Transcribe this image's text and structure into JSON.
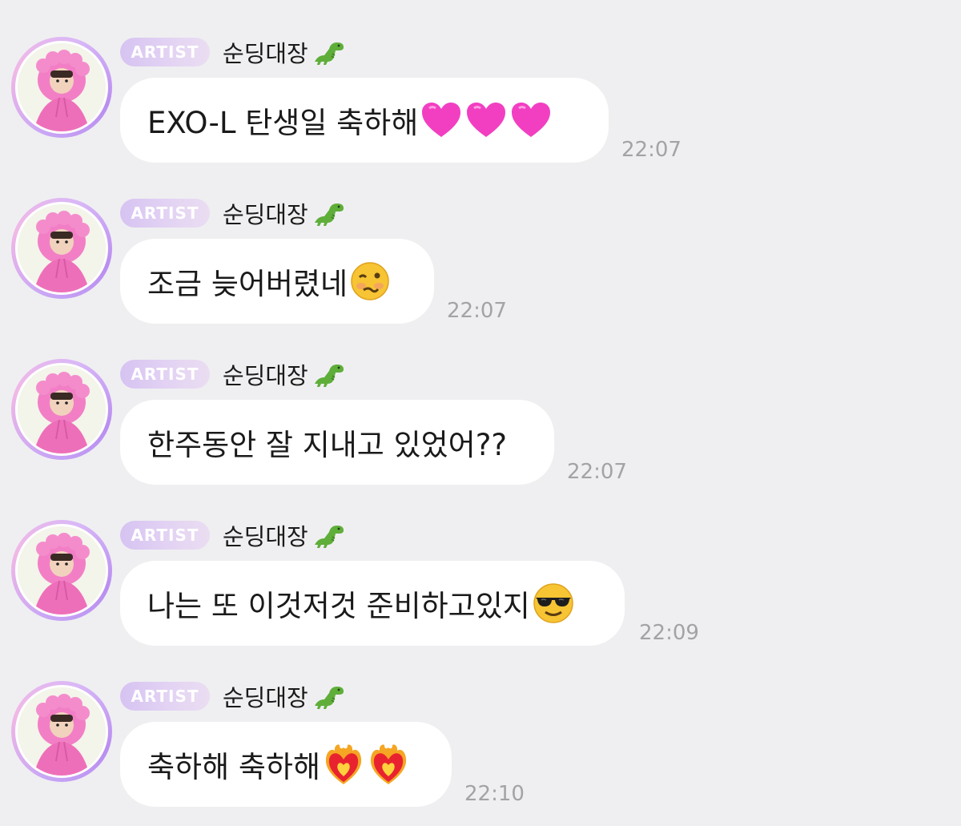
{
  "messages": [
    {
      "badge": "ARTIST",
      "sender": "순딩대장",
      "sender_icon": "t-rex-icon",
      "text": "EXO-L 탄생일 축하해",
      "emojis": [
        "pink-heart-icon",
        "pink-heart-icon",
        "pink-heart-icon"
      ],
      "time": "22:07"
    },
    {
      "badge": "ARTIST",
      "sender": "순딩대장",
      "sender_icon": "t-rex-icon",
      "text": "조금 늦어버렸네",
      "emojis": [
        "woozy-face-icon"
      ],
      "time": "22:07"
    },
    {
      "badge": "ARTIST",
      "sender": "순딩대장",
      "sender_icon": "t-rex-icon",
      "text": "한주동안 잘 지내고 있었어??",
      "emojis": [],
      "time": "22:07"
    },
    {
      "badge": "ARTIST",
      "sender": "순딩대장",
      "sender_icon": "t-rex-icon",
      "text": "나는 또 이것저것 준비하고있지",
      "emojis": [
        "sunglasses-face-icon"
      ],
      "time": "22:09"
    },
    {
      "badge": "ARTIST",
      "sender": "순딩대장",
      "sender_icon": "t-rex-icon",
      "text": "축하해 축하해",
      "emojis": [
        "heart-on-fire-icon",
        "heart-on-fire-icon"
      ],
      "time": "22:10"
    }
  ],
  "colors": {
    "background": "#efeff1",
    "bubble": "#ffffff",
    "badge_text": "#ffffff",
    "badge_gradient_start": "#d6c3f2",
    "timestamp": "#a3a3a6",
    "avatar_ring": "#c9a6f5",
    "avatar_hood": "#f17fc4"
  }
}
